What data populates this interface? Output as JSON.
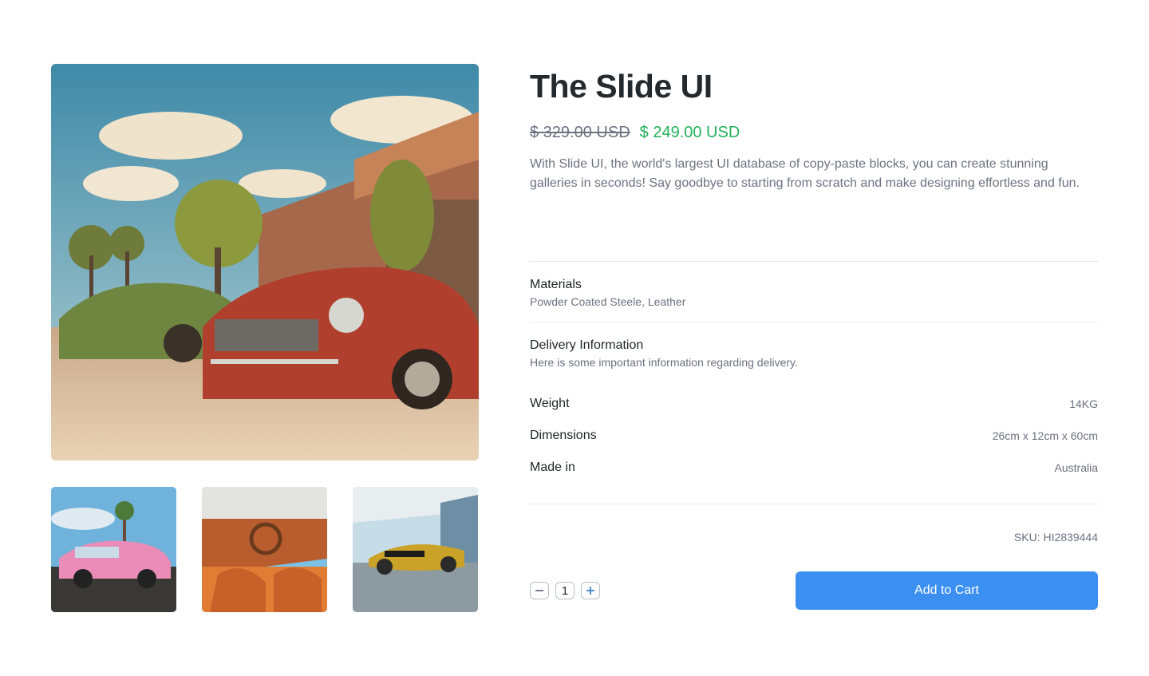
{
  "product": {
    "title": "The Slide UI",
    "old_price": "$ 329.00 USD",
    "new_price": "$ 249.00 USD",
    "description": "With Slide UI, the world's largest UI database of copy-paste blocks, you can create stunning galleries in seconds! Say goodbye to starting from scratch and make designing effortless and fun."
  },
  "info": {
    "materials_title": "Materials",
    "materials_value": "Powder Coated Steele, Leather",
    "delivery_title": "Delivery Information",
    "delivery_value": "Here is some important information regarding delivery."
  },
  "specs": [
    {
      "label": "Weight",
      "value": "14KG"
    },
    {
      "label": "Dimensions",
      "value": "26cm x 12cm x 60cm"
    },
    {
      "label": "Made in",
      "value": "Australia"
    }
  ],
  "sku": "SKU: HI2839444",
  "quantity": "1",
  "cart_button_label": "Add to Cart",
  "icons": {
    "minus": "minus-icon",
    "plus": "plus-icon"
  },
  "colors": {
    "accent": "#3b8ff1",
    "sale_price": "#22b15a",
    "muted_text": "#6b7280"
  }
}
